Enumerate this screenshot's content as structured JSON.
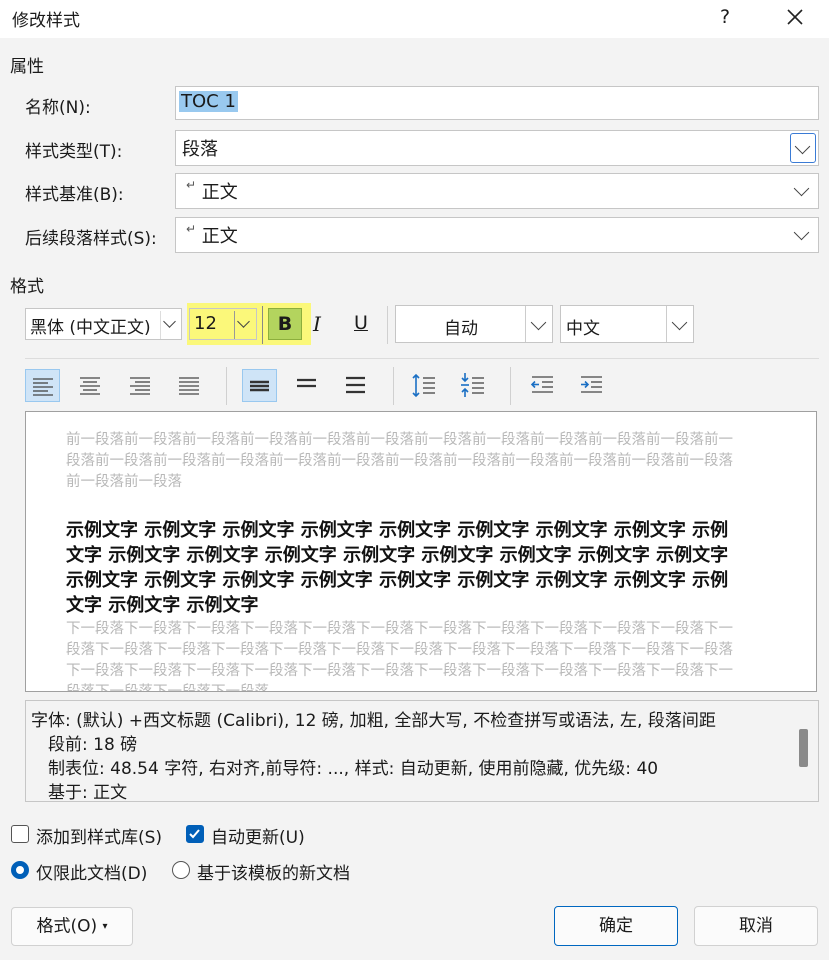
{
  "dialog": {
    "title": "修改样式",
    "help": "?",
    "close": "✕"
  },
  "properties": {
    "section": "属性",
    "name_label": "名称(N):",
    "name_value": "TOC 1",
    "type_label": "样式类型(T):",
    "type_value": "段落",
    "based_label": "样式基准(B):",
    "based_value": "正文",
    "next_label": "后续段落样式(S):",
    "next_value": "正文",
    "para_mark": "↵"
  },
  "format": {
    "section": "格式",
    "font": "黑体 (中文正文)",
    "size": "12",
    "bold": "B",
    "italic": "I",
    "underline": "U",
    "color": "自动",
    "lang": "中文"
  },
  "preview": {
    "prev_para": "前一段落前一段落前一段落前一段落前一段落前一段落前一段落前一段落前一段落前一段落前一段落前一段落前一段落前一段落前一段落前一段落前一段落前一段落前一段落前一段落前一段落前一段落前一段落前一段落前一段落",
    "sample": "示例文字 示例文字 示例文字 示例文字 示例文字 示例文字 示例文字 示例文字 示例文字 示例文字 示例文字 示例文字 示例文字 示例文字 示例文字 示例文字 示例文字 示例文字 示例文字 示例文字 示例文字 示例文字 示例文字 示例文字 示例文字 示例文字 示例文字 示例文字",
    "next_para": "下一段落下一段落下一段落下一段落下一段落下一段落下一段落下一段落下一段落下一段落下一段落下一段落下一段落下一段落下一段落下一段落下一段落下一段落下一段落下一段落下一段落下一段落下一段落下一段落下一段落下一段落下一段落下一段落下一段落下一段落下一段落下一段落下一段落下一段落下一段落下一段落下一段落下一段落"
  },
  "description": {
    "line1": "字体: (默认) +西文标题 (Calibri), 12 磅, 加粗, 全部大写, 不检查拼写或语法, 左, 段落间距",
    "line2": "段前: 18 磅",
    "line3": "制表位:  48.54 字符, 右对齐,前导符: ..., 样式: 自动更新, 使用前隐藏, 优先级: 40",
    "line4": "基于: 正文"
  },
  "options": {
    "add_gallery": "添加到样式库(S)",
    "add_gallery_checked": false,
    "auto_update": "自动更新(U)",
    "auto_update_checked": true,
    "this_doc": "仅限此文档(D)",
    "template_doc": "基于该模板的新文档"
  },
  "buttons": {
    "format": "格式(O)",
    "ok": "确定",
    "cancel": "取消"
  },
  "colors": {
    "accent": "#005fb8",
    "highlight": "#fbf87a",
    "selection": "#cfe4f7"
  }
}
